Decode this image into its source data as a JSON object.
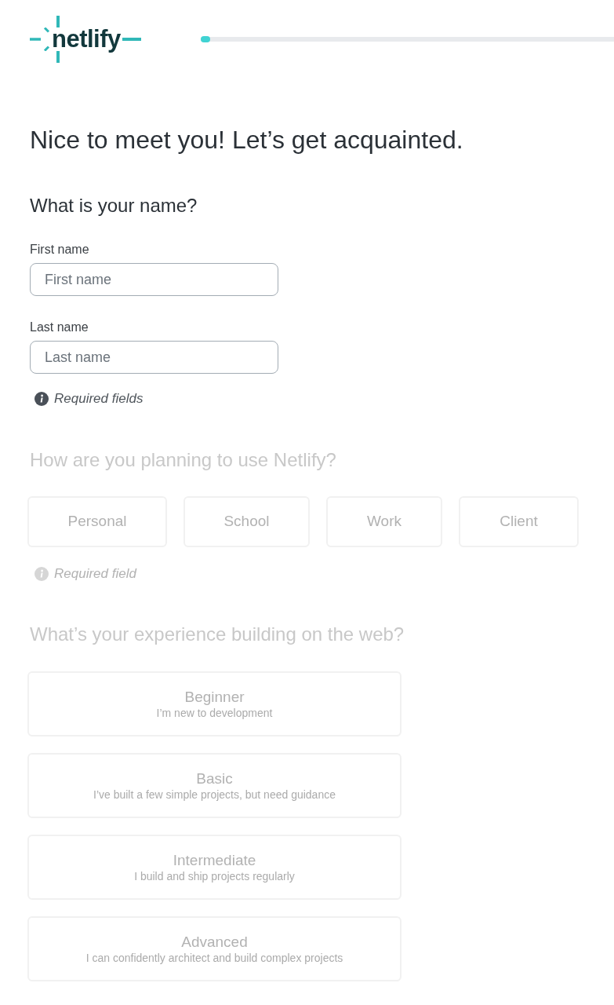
{
  "header": {
    "logo": "netlify",
    "progress": {
      "level": 0.023
    }
  },
  "title": "Nice to meet you! Let’s get acquainted.",
  "sections": [
    {
      "kind": "name",
      "heading": "What is your name?",
      "disabled": false,
      "fields": [
        {
          "label": "First name",
          "placeholder": "First name"
        },
        {
          "label": "Last name",
          "placeholder": "Last name"
        }
      ],
      "note": "Required fields"
    },
    {
      "kind": "choices",
      "heading": "How are you planning to use Netlify?",
      "disabled": true,
      "options": [
        {
          "label": "Personal",
          "selected": false
        },
        {
          "label": "School",
          "selected": false
        },
        {
          "label": "Work",
          "selected": false
        },
        {
          "label": "Client",
          "selected": false
        }
      ],
      "note": "Required field"
    },
    {
      "kind": "levels",
      "heading": "What’s your experience building on the web?",
      "disabled": true,
      "options": [
        {
          "title": "Beginner",
          "description": "I’m new to development",
          "selected": false
        },
        {
          "title": "Basic",
          "description": "I’ve built a few simple projects, but need guidance",
          "selected": false
        },
        {
          "title": "Intermediate",
          "description": "I build and ship projects regularly",
          "selected": false
        },
        {
          "title": "Advanced",
          "description": "I can confidently architect and build complex projects",
          "selected": false
        }
      ]
    }
  ]
}
